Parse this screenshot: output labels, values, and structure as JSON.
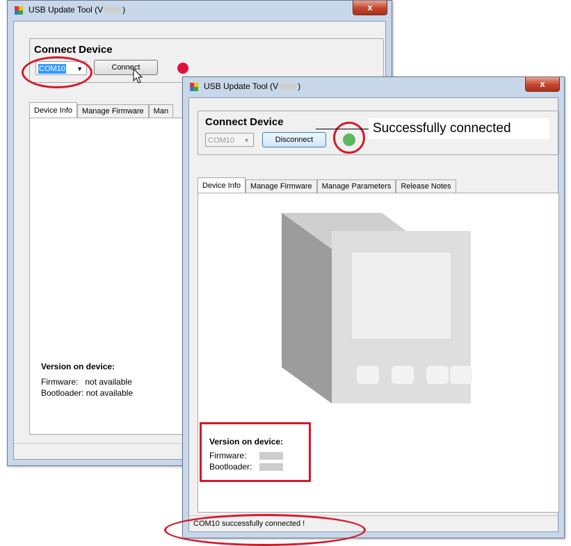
{
  "back_window": {
    "title": "USB Update Tool  (V",
    "title_suffix": ")",
    "close_label": "x",
    "group_title": "Connect Device",
    "com_port": "COM10",
    "connect_button": "Connect",
    "status_led_color": "#e0103a",
    "tabs": [
      "Device Info",
      "Manage Firmware",
      "Man"
    ],
    "version_title": "Version on device:",
    "firmware_label": "Firmware:",
    "firmware_value": "not available",
    "bootloader_label": "Bootloader:",
    "bootloader_value": "not available"
  },
  "front_window": {
    "title": "USB Update Tool  (V",
    "title_suffix": ")",
    "close_label": "x",
    "group_title": "Connect Device",
    "com_port": "COM10",
    "disconnect_button": "Disconnect",
    "status_led_color": "#5cb85c",
    "tabs": [
      "Device Info",
      "Manage Firmware",
      "Manage Parameters",
      "Release Notes"
    ],
    "version_title": "Version on device:",
    "firmware_label": "Firmware:",
    "bootloader_label": "Bootloader:",
    "status_text": "COM10 successfully connected !"
  },
  "callout": {
    "text": "Successfully connected"
  },
  "colors": {
    "annotation_red": "#d7182a",
    "window_frame": "#c9d7ea"
  }
}
